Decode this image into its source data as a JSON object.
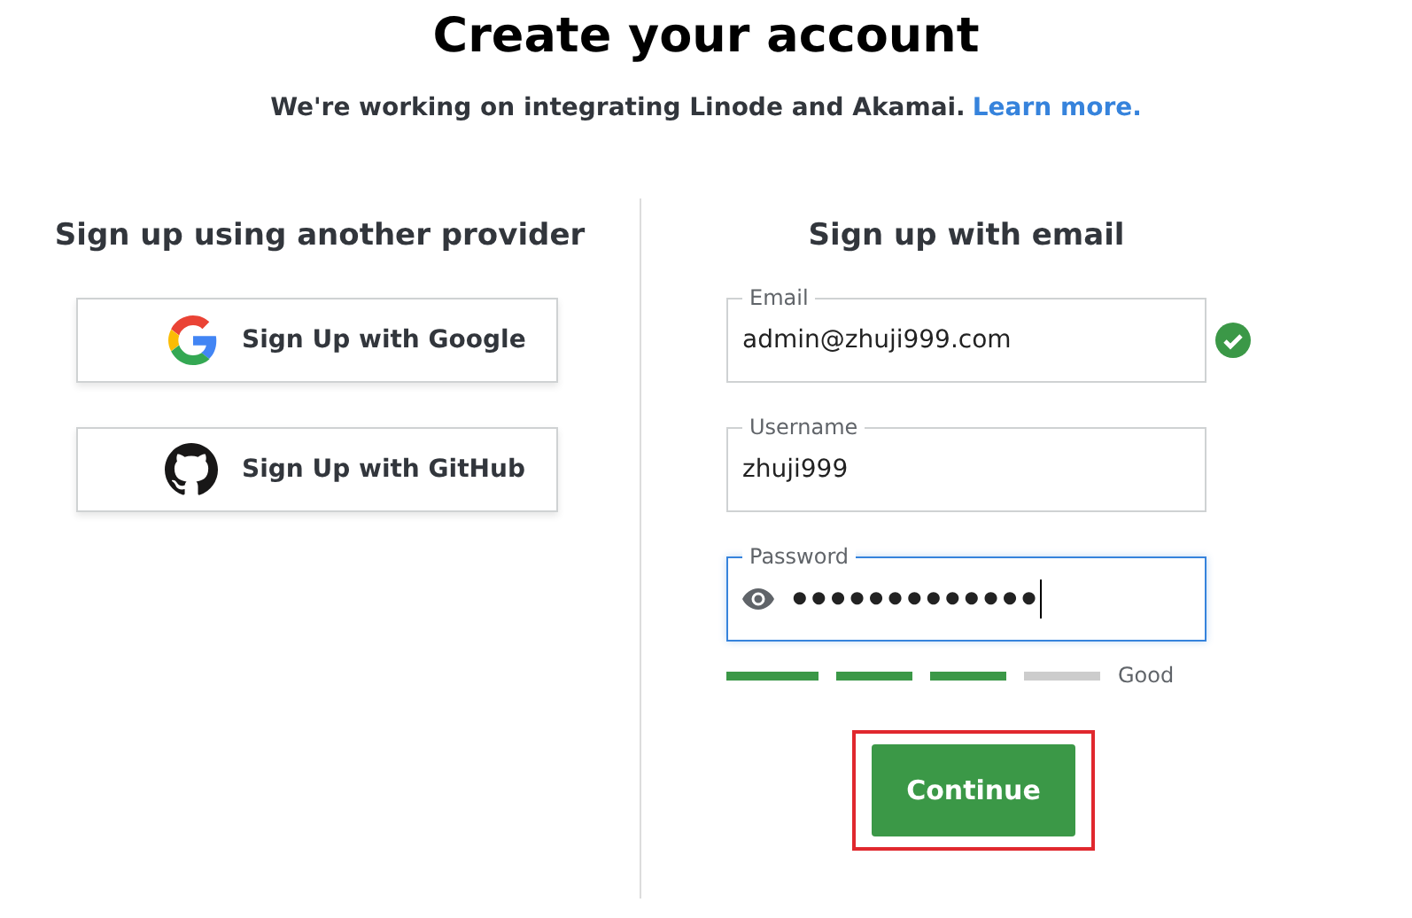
{
  "title": "Create your account",
  "notice": {
    "text": "We're working on integrating Linode and Akamai.",
    "link": "Learn more."
  },
  "providers": {
    "heading": "Sign up using another provider",
    "buttons": [
      {
        "kind": "google",
        "label": "Sign Up with Google"
      },
      {
        "kind": "github",
        "label": "Sign Up with GitHub"
      }
    ]
  },
  "email_signup": {
    "heading": "Sign up with email",
    "fields": [
      {
        "kind": "text",
        "label": "Email",
        "value": "admin@zhuji999.com",
        "valid": true,
        "focused": false
      },
      {
        "kind": "text",
        "label": "Username",
        "value": "zhuji999",
        "valid": false,
        "focused": false
      },
      {
        "kind": "password",
        "label": "Password",
        "value": "•••••••••••••",
        "valid": false,
        "focused": true
      }
    ],
    "strength": {
      "level": 0.75,
      "label": "Good"
    },
    "button": {
      "label": "Continue",
      "highlighted": true
    }
  }
}
